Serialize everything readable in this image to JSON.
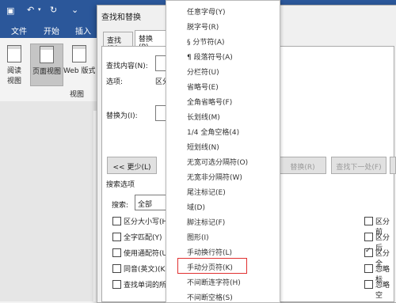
{
  "word": {
    "tabs": [
      "文件",
      "开始",
      "插入"
    ],
    "view_buttons": [
      {
        "label": "阅读\n视图"
      },
      {
        "label": "页面视图"
      },
      {
        "label": "Web 版式"
      }
    ],
    "view_group_label": "视图"
  },
  "dialog": {
    "title": "查找和替换",
    "tabs": [
      "查找(D)",
      "替换(P)"
    ],
    "find_label": "查找内容(N):",
    "options_label": "选项:",
    "options_value_partial": "区分",
    "replace_label": "替换为(I):",
    "less_button": "<< 更少(L)",
    "replace_button": "替换(R)",
    "find_next_button": "查找下一处(F)",
    "search_options_label": "搜索选项",
    "search_label": "搜索:",
    "search_value": "全部",
    "left_checks": [
      {
        "label": "区分大小写(H)",
        "checked": false
      },
      {
        "label": "全字匹配(Y)",
        "checked": false
      },
      {
        "label": "使用通配符(U)",
        "checked": false
      },
      {
        "label": "同音(英文)(K)",
        "checked": false
      },
      {
        "label": "查找单词的所",
        "checked": false
      }
    ],
    "right_checks": [
      {
        "label": "区分前",
        "checked": false
      },
      {
        "label": "区分后",
        "checked": false
      },
      {
        "label": "区分全",
        "checked": true
      },
      {
        "label": "忽略标",
        "checked": false
      },
      {
        "label": "忽略空",
        "checked": false
      }
    ]
  },
  "special_menu": {
    "items": [
      "任意字母(Y)",
      "脱字号(R)",
      "§ 分节符(A)",
      "¶ 段落符号(A)",
      "分栏符(U)",
      "省略号(E)",
      "全角省略号(F)",
      "长划线(M)",
      "1/4 全角空格(4)",
      "短划线(N)",
      "无宽可选分隔符(O)",
      "无宽非分隔符(W)",
      "尾注标记(E)",
      "域(D)",
      "脚注标记(F)",
      "图形(I)",
      "手动换行符(L)",
      "手动分页符(K)",
      "不间断连字符(H)",
      "不间断空格(S)"
    ],
    "highlighted_item": "手动分页符(K)",
    "highlight_color": "#e03030"
  }
}
